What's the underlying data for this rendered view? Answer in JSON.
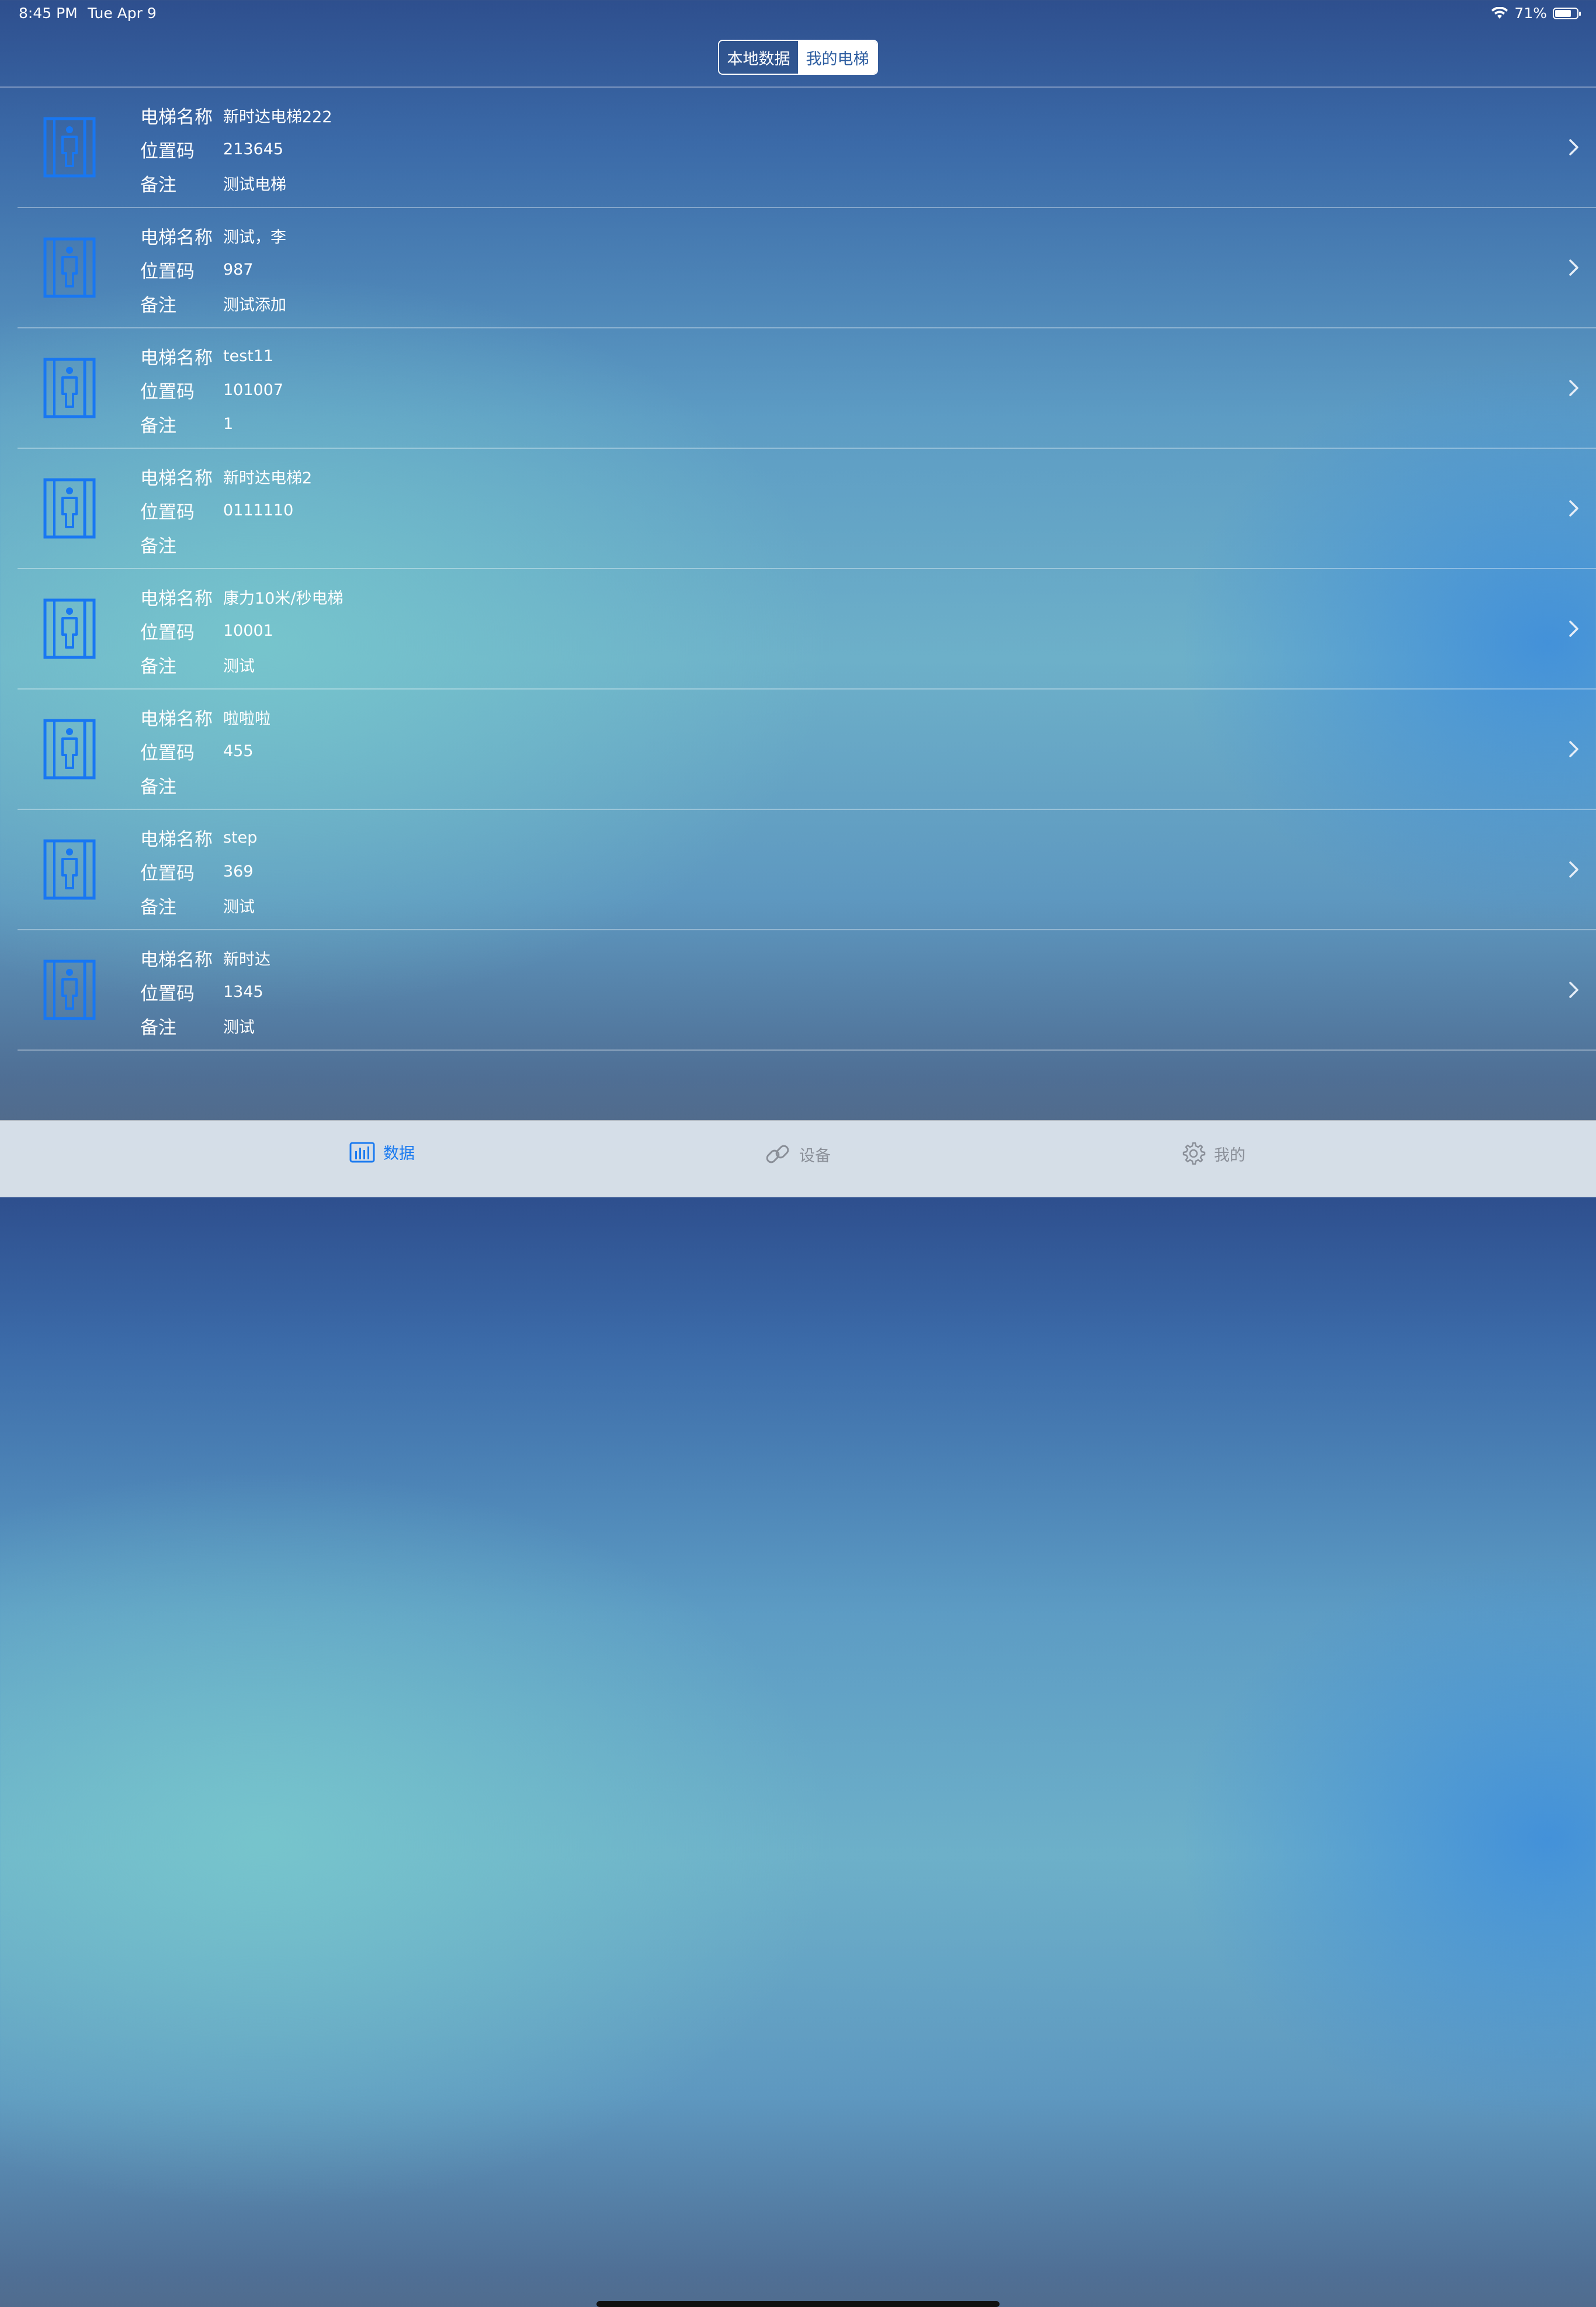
{
  "status_bar": {
    "time": "8:45 PM",
    "date": "Tue Apr 9",
    "battery": "71%"
  },
  "segmented_control": {
    "local_label": "本地数据",
    "mine_label": "我的电梯",
    "selected": "我的电梯"
  },
  "field_labels": {
    "name": "电梯名称",
    "code": "位置码",
    "note": "备注"
  },
  "elevators": [
    {
      "name": "新时达电梯222",
      "code": "213645",
      "note": "测试电梯"
    },
    {
      "name": "测试，李",
      "code": "987",
      "note": "测试添加"
    },
    {
      "name": "test11",
      "code": "101007",
      "note": "1"
    },
    {
      "name": "新时达电梯2",
      "code": "0111110",
      "note": ""
    },
    {
      "name": "康力10米/秒电梯",
      "code": "10001",
      "note": "测试"
    },
    {
      "name": "啦啦啦",
      "code": "455",
      "note": ""
    },
    {
      "name": "step",
      "code": "369",
      "note": "测试"
    },
    {
      "name": "新时达",
      "code": "1345",
      "note": "测试"
    }
  ],
  "tab_bar": {
    "tabs": [
      {
        "label": "数据",
        "icon": "bar-chart-icon",
        "active": true
      },
      {
        "label": "设备",
        "icon": "link-icon",
        "active": false
      },
      {
        "label": "我的",
        "icon": "gear-icon",
        "active": false
      }
    ]
  },
  "colors": {
    "accent": "#1a7af0",
    "icon_blue": "#1877f2",
    "tab_inactive": "#8a8f98"
  }
}
